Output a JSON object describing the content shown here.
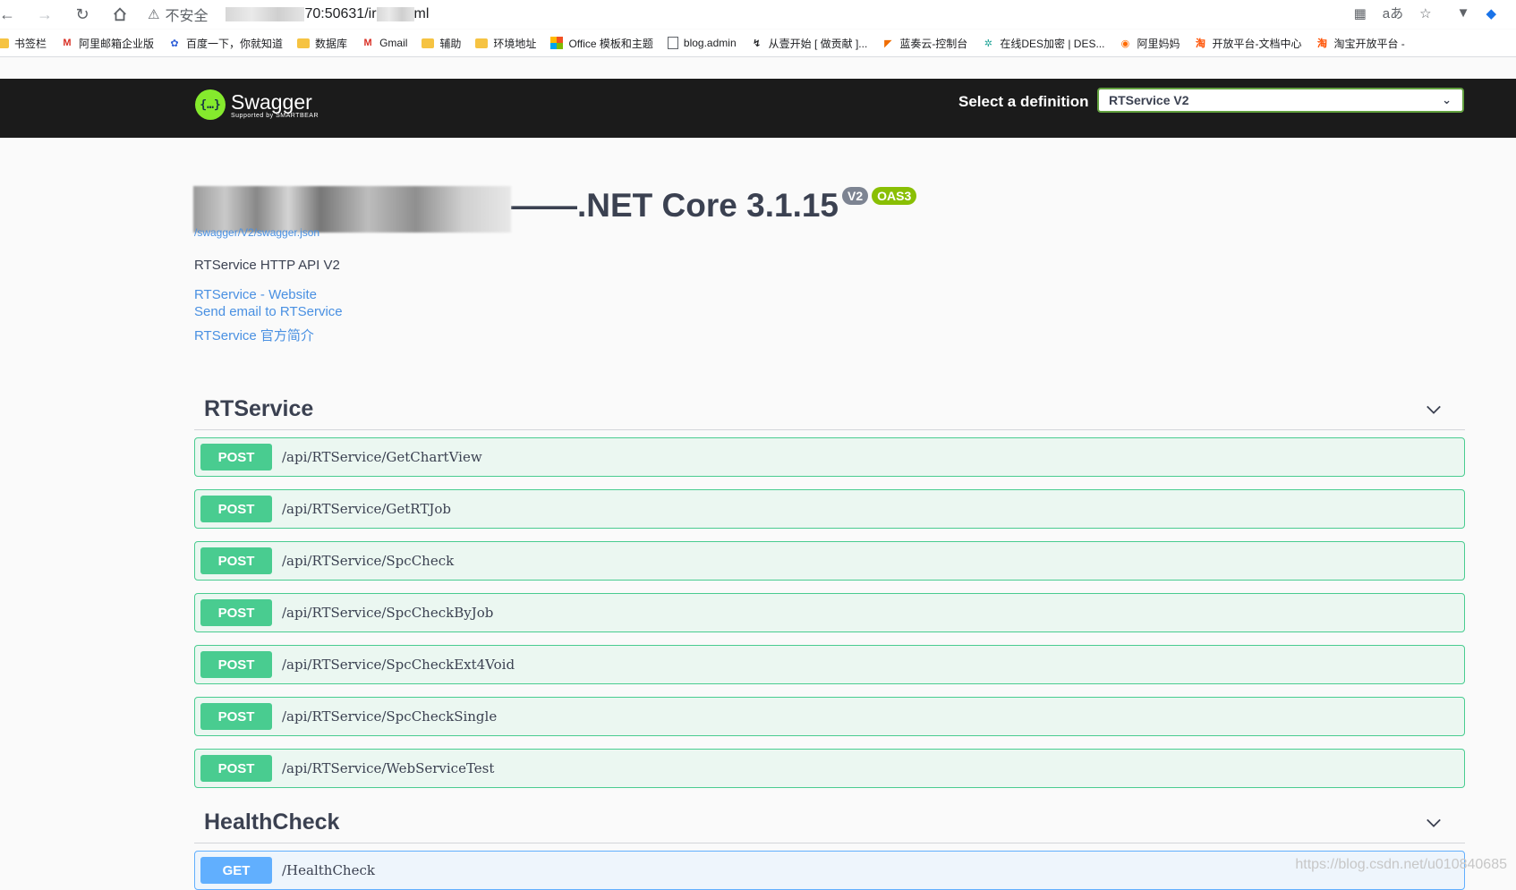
{
  "browser": {
    "insecure_label": "不安全",
    "url_visible": "70:50631/ir",
    "url_suffix": "ml"
  },
  "bookmarks": [
    {
      "label": "书签栏",
      "icon": "folder-icon"
    },
    {
      "label": "阿里邮箱企业版",
      "icon": "mail-icon"
    },
    {
      "label": "百度一下，你就知道",
      "icon": "baidu-icon"
    },
    {
      "label": "数据库",
      "icon": "folder-icon"
    },
    {
      "label": "Gmail",
      "icon": "gmail-icon"
    },
    {
      "label": "辅助",
      "icon": "folder-icon"
    },
    {
      "label": "环境地址",
      "icon": "folder-icon"
    },
    {
      "label": "Office 模板和主题",
      "icon": "office-icon"
    },
    {
      "label": "blog.admin",
      "icon": "page-icon"
    },
    {
      "label": "从壹开始 [ 做贡献 ]...",
      "icon": "link-icon"
    },
    {
      "label": "蓝奏云-控制台",
      "icon": "flag-icon"
    },
    {
      "label": "在线DES加密 | DES...",
      "icon": "gear-icon"
    },
    {
      "label": "阿里妈妈",
      "icon": "alimama-icon"
    },
    {
      "label": "开放平台-文档中心",
      "icon": "taobao-icon"
    },
    {
      "label": "淘宝开放平台 -",
      "icon": "taobao-icon"
    }
  ],
  "swagger": {
    "brand": "Swagger",
    "brand_sub": "Supported by SMARTBEAR",
    "definition_label": "Select a definition",
    "definition_value": "RTService V2"
  },
  "info": {
    "title_suffix": "——.NET Core 3.1.15",
    "version_badge": "V2",
    "oas_badge": "OAS3",
    "json_link": "/swagger/V2/swagger.json",
    "description": "RTService HTTP API V2",
    "links": [
      "RTService - Website",
      "Send email to RTService",
      "RTService 官方简介"
    ]
  },
  "sections": [
    {
      "name": "RTService",
      "operations": [
        {
          "method": "POST",
          "path": "/api/RTService/GetChartView"
        },
        {
          "method": "POST",
          "path": "/api/RTService/GetRTJob"
        },
        {
          "method": "POST",
          "path": "/api/RTService/SpcCheck"
        },
        {
          "method": "POST",
          "path": "/api/RTService/SpcCheckByJob"
        },
        {
          "method": "POST",
          "path": "/api/RTService/SpcCheckExt4Void"
        },
        {
          "method": "POST",
          "path": "/api/RTService/SpcCheckSingle"
        },
        {
          "method": "POST",
          "path": "/api/RTService/WebServiceTest"
        }
      ]
    },
    {
      "name": "HealthCheck",
      "operations": [
        {
          "method": "GET",
          "path": "/HealthCheck"
        }
      ]
    }
  ],
  "watermark": "https://blog.csdn.net/u010840685",
  "colors": {
    "post": "#49cc90",
    "get": "#61affe",
    "topbar": "#1b1b1b",
    "logo": "#85ea2d"
  }
}
